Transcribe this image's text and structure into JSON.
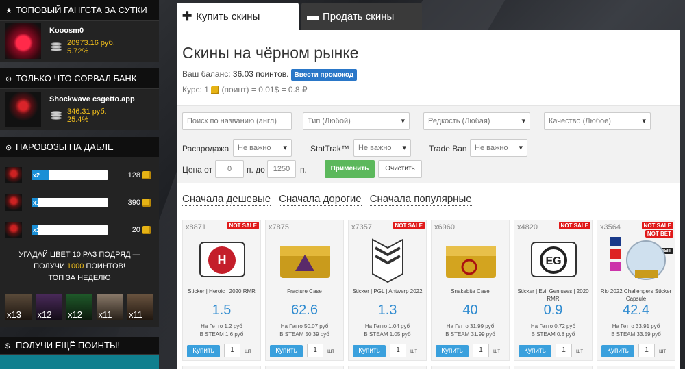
{
  "sidebar": {
    "top_gangsta": {
      "title": "ТОПОВЫЙ ГАНГСТА ЗА СУТКИ",
      "user": "Kooosm0",
      "amount": "20973.16 руб.",
      "percent": "5.72%"
    },
    "bank": {
      "title": "ТОЛЬКО ЧТО СОРВАЛ БАНК",
      "user": "Shockwave csgetto.app",
      "amount": "346.31 руб.",
      "percent": "25.4%"
    },
    "trains": {
      "title": "ПАРОВОЗЫ НА ДАБЛЕ",
      "items": [
        {
          "mult": "x2",
          "count": "128",
          "fill": 0.22
        },
        {
          "mult": "x1",
          "count": "390",
          "fill": 0.09
        },
        {
          "mult": "x1",
          "count": "20",
          "fill": 0.09
        }
      ],
      "promo_line1": "УГАДАЙ ЦВЕТ 10 РАЗ ПОДРЯД —",
      "promo_line2_a": "ПОЛУЧИ ",
      "promo_line2_b": "1000",
      "promo_line2_c": " ПОИНТОВ!",
      "promo_line3": "ТОП ЗА НЕДЕЛЮ",
      "tops": [
        "x13",
        "x12",
        "x12",
        "x11",
        "x11"
      ]
    },
    "more_points": {
      "title": "ПОЛУЧИ ЕЩЁ ПОИНТЫ!"
    }
  },
  "tabs": {
    "buy": "Купить скины",
    "sell": "Продать скины"
  },
  "header": {
    "title": "Скины на чёрном рынке",
    "balance_label": "Ваш баланс: ",
    "balance_value": "36.03 поинтов.",
    "promo_button": "Ввести промокод",
    "rate_a": "Курс: 1 ",
    "rate_b": " (поинт) = 0.01$ = 0.8 ₽"
  },
  "filters": {
    "search_placeholder": "Поиск по названию (англ)",
    "type": "Тип (Любой)",
    "rarity": "Редкость (Любая)",
    "quality": "Качество (Любое)",
    "sale_label": "Распродажа",
    "sale_value": "Не важно",
    "stattrak_label": "StatTrak™",
    "stattrak_value": "Не важно",
    "tradeban_label": "Trade Ban",
    "tradeban_value": "Не важно",
    "price_label": "Цена от",
    "price_from": "0",
    "price_to_label": "п. до",
    "price_to": "1250",
    "price_unit": "п.",
    "apply": "Применить",
    "clear": "Очистить"
  },
  "sort": {
    "cheap": "Сначала дешевые",
    "expensive": "Сначала дорогие",
    "popular": "Сначала популярные"
  },
  "items": [
    {
      "count": "x8871",
      "badge": "NOT SALE",
      "name": "Sticker | Heroic | 2020 RMR",
      "price": "1.5",
      "getto": "На Гетто 1.2 руб",
      "steam": "В STEAM 1.6 руб"
    },
    {
      "count": "x7875",
      "badge": "",
      "name": "Fracture Case",
      "price": "62.6",
      "getto": "На Гетто 50.07 руб",
      "steam": "В STEAM 50.39 руб"
    },
    {
      "count": "x7357",
      "badge": "NOT SALE",
      "name": "Sticker | PGL | Antwerp 2022",
      "price": "1.3",
      "getto": "На Гетто 1.04 руб",
      "steam": "В STEAM 1.05 руб"
    },
    {
      "count": "x6960",
      "badge": "",
      "name": "Snakebite Case",
      "price": "40",
      "getto": "На Гетто 31.99 руб",
      "steam": "В STEAM 31.99 руб"
    },
    {
      "count": "x4820",
      "badge": "NOT SALE",
      "name": "Sticker | Evil Geniuses | 2020 RMR",
      "price": "0.9",
      "getto": "На Гетто 0.72 руб",
      "steam": "В STEAM 0.8 руб"
    },
    {
      "count": "x3564",
      "badge": "NOT SALE",
      "badge2": "NOT BET",
      "badge3": "NOT DEPOSIT",
      "name": "Rio 2022 Challengers Sticker Capsule",
      "price": "42.4",
      "getto": "На Гетто 33.91 руб",
      "steam": "В STEAM 33.59 руб"
    }
  ],
  "buy_label": "Купить",
  "qty_default": "1",
  "qty_unit": "шт",
  "colors": {
    "accent": "#2f8bd0",
    "buy": "#3aa0dd",
    "apply": "#5cb85c",
    "badge": "#e01a1a",
    "gold": "#f3c01c"
  }
}
